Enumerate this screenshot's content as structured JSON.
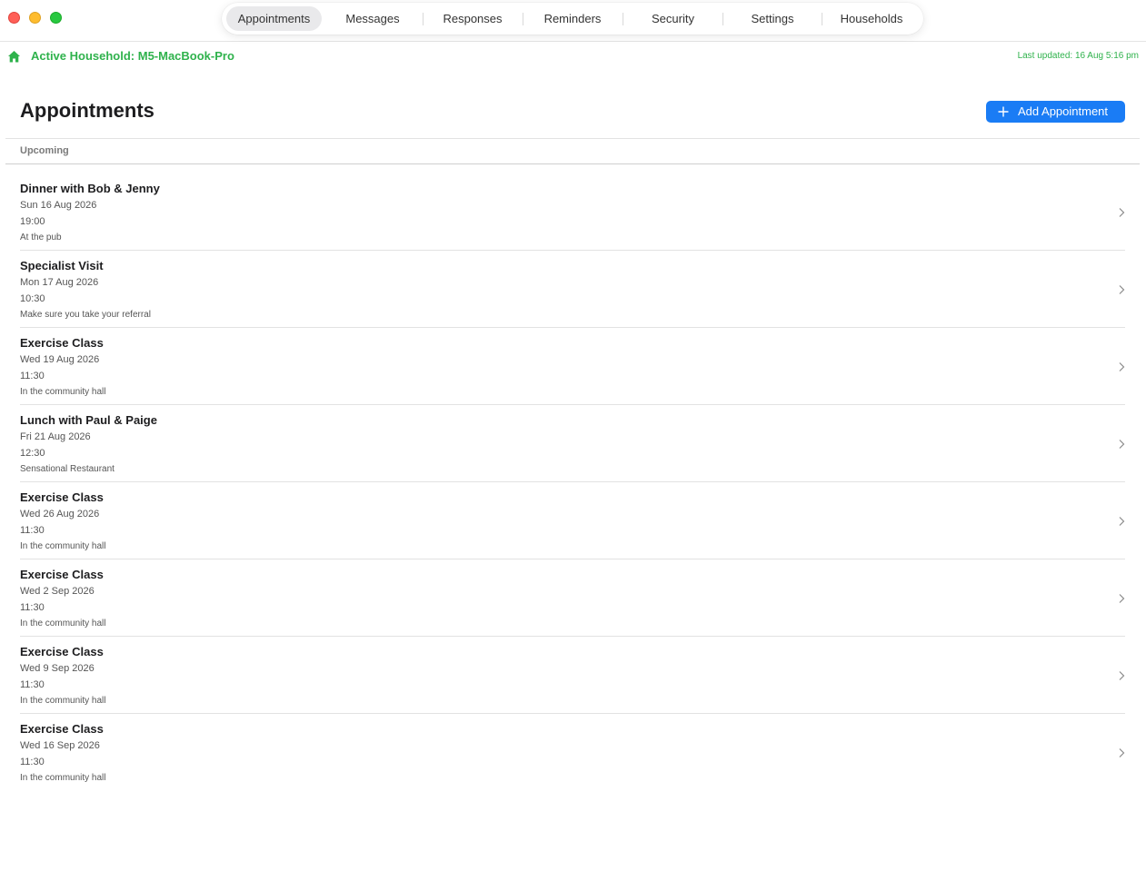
{
  "tabs": [
    {
      "label": "Appointments",
      "active": true
    },
    {
      "label": "Messages",
      "active": false
    },
    {
      "label": "Responses",
      "active": false
    },
    {
      "label": "Reminders",
      "active": false
    },
    {
      "label": "Security",
      "active": false
    },
    {
      "label": "Settings",
      "active": false
    },
    {
      "label": "Households",
      "active": false
    }
  ],
  "household": {
    "label": "Active Household: M5-MacBook-Pro",
    "icon": "house-icon",
    "last_updated": "Last updated: 16 Aug 5:16 pm"
  },
  "header": {
    "title": "Appointments",
    "add_button_label": "Add Appointment",
    "add_button_icon": "plus-icon"
  },
  "section": {
    "label": "Upcoming"
  },
  "appointments": [
    {
      "title": "Dinner with Bob & Jenny",
      "date": "Sun 16 Aug 2026",
      "time": "19:00",
      "note": "At the pub"
    },
    {
      "title": "Specialist Visit",
      "date": "Mon 17 Aug 2026",
      "time": "10:30",
      "note": "Make sure you take your referral"
    },
    {
      "title": "Exercise Class",
      "date": "Wed 19 Aug 2026",
      "time": "11:30",
      "note": "In the community hall"
    },
    {
      "title": "Lunch with Paul & Paige",
      "date": "Fri 21 Aug 2026",
      "time": "12:30",
      "note": "Sensational Restaurant"
    },
    {
      "title": "Exercise Class",
      "date": "Wed 26 Aug 2026",
      "time": "11:30",
      "note": "In the community hall"
    },
    {
      "title": "Exercise Class",
      "date": "Wed 2 Sep 2026",
      "time": "11:30",
      "note": "In the community hall"
    },
    {
      "title": "Exercise Class",
      "date": "Wed 9 Sep 2026",
      "time": "11:30",
      "note": "In the community hall"
    },
    {
      "title": "Exercise Class",
      "date": "Wed 16 Sep 2026",
      "time": "11:30",
      "note": "In the community hall"
    }
  ],
  "colors": {
    "accent": "#1a7cf5",
    "household_green": "#2fb24c"
  }
}
